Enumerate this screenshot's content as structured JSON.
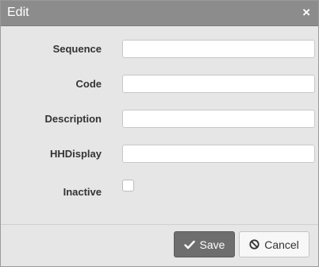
{
  "dialog": {
    "title": "Edit",
    "close_glyph": "×"
  },
  "form": {
    "fields": [
      {
        "label": "Sequence",
        "value": ""
      },
      {
        "label": "Code",
        "value": ""
      },
      {
        "label": "Description",
        "value": ""
      },
      {
        "label": "HHDisplay",
        "value": ""
      }
    ],
    "inactive": {
      "label": "Inactive",
      "checked": false
    }
  },
  "footer": {
    "save_label": "Save",
    "save_icon": "check-icon",
    "cancel_label": "Cancel",
    "cancel_icon": "ban-icon"
  }
}
